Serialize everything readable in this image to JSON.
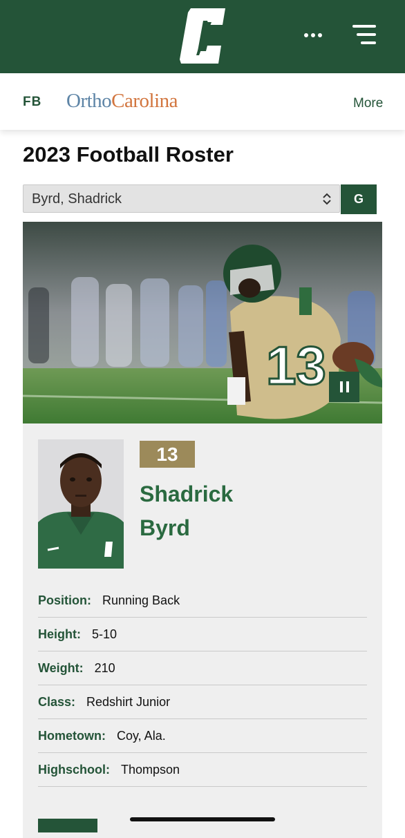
{
  "header": {
    "logo_icon": "charlotte-c-logo-icon",
    "more_dots_icon": "ellipsis-icon",
    "menu_icon": "hamburger-menu-icon",
    "brand_color": "#245438"
  },
  "subnav": {
    "sport": "FB",
    "sponsor_part1": "Ortho",
    "sponsor_part2": "Carolina",
    "more_label": "More"
  },
  "page": {
    "title": "2023 Football Roster"
  },
  "roster_select": {
    "selected": "Byrd, Shadrick",
    "go_label": "G"
  },
  "hero": {
    "pause_icon": "pause-icon",
    "jersey_number": "13"
  },
  "player": {
    "number": "13",
    "first_name": "Shadrick",
    "last_name": "Byrd",
    "accent_color": "#9c8a5a",
    "details": [
      {
        "label": "Position:",
        "value": "Running Back"
      },
      {
        "label": "Height:",
        "value": "5-10"
      },
      {
        "label": "Weight:",
        "value": "210"
      },
      {
        "label": "Class:",
        "value": "Redshirt Junior"
      },
      {
        "label": "Hometown:",
        "value": "Coy, Ala."
      },
      {
        "label": "Highschool:",
        "value": "Thompson"
      }
    ]
  }
}
